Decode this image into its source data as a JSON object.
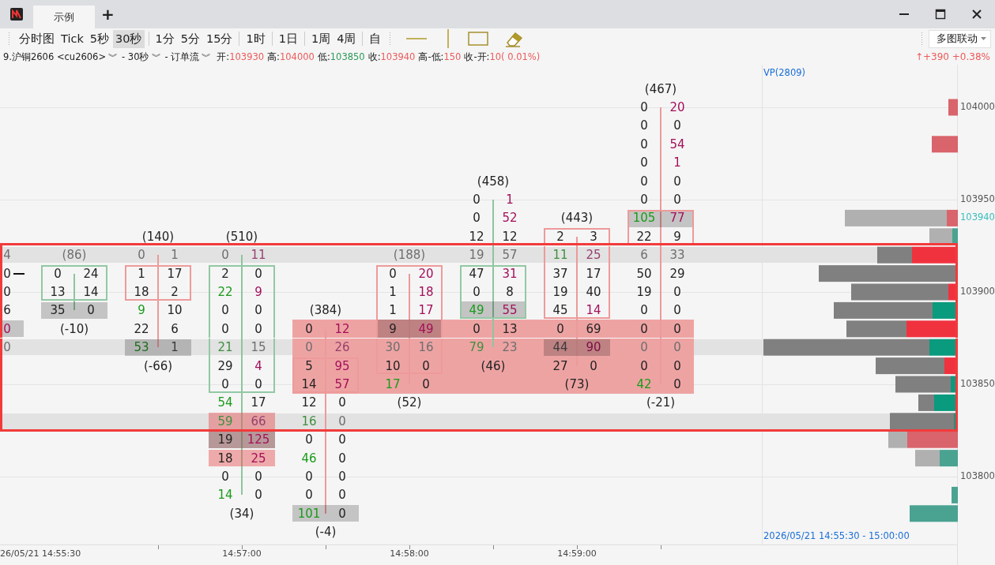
{
  "window": {
    "tabs": [
      {
        "label": "示例",
        "selected": true
      }
    ],
    "add_tab": "+"
  },
  "toolbar": {
    "period_groups": [
      [
        {
          "label": "分时图",
          "selected": false
        },
        {
          "label": "Tick",
          "selected": false
        },
        {
          "label": "5秒",
          "selected": false
        },
        {
          "label": "30秒",
          "selected": true
        }
      ],
      [
        {
          "label": "1分",
          "selected": false
        },
        {
          "label": "5分",
          "selected": false
        },
        {
          "label": "15分",
          "selected": false
        }
      ],
      [
        {
          "label": "1时",
          "selected": false
        }
      ],
      [
        {
          "label": "1日",
          "selected": false
        }
      ],
      [
        {
          "label": "1周",
          "selected": false
        },
        {
          "label": "4周",
          "selected": false
        }
      ],
      [
        {
          "label": "自",
          "selected": false
        }
      ]
    ],
    "tools": [
      {
        "kind": "hline"
      },
      {
        "kind": "vline"
      },
      {
        "kind": "rect"
      },
      {
        "kind": "eraser"
      }
    ],
    "link_menu": {
      "label": "多图联动"
    }
  },
  "info": {
    "selectors": [
      {
        "label": "9.沪铜2606 <cu2606>",
        "menu": "︾"
      },
      {
        "label": "- 30秒",
        "menu": "︾"
      },
      {
        "label": "- 订单流",
        "menu": "︾"
      }
    ],
    "stats": [
      {
        "label": "开:",
        "value": "103930",
        "rising": true
      },
      {
        "label": "高:",
        "value": "104000",
        "rising": true
      },
      {
        "label": "低:",
        "value": "103850",
        "rising": false
      },
      {
        "label": "收:",
        "value": "103940",
        "rising": true
      },
      {
        "label": "高-低:",
        "value": "150",
        "rising": true
      },
      {
        "label": "收-开:",
        "value": "10( 0.01%)",
        "rising": true
      }
    ],
    "change": {
      "text": "↑+390 +0.38%",
      "rising": true
    }
  },
  "chart": {
    "rows": [
      {},
      {
        "axis_label": "104000"
      },
      {},
      {},
      {},
      {},
      {
        "axis_label": "103950"
      },
      {
        "axis_label": "103940",
        "current": true
      },
      {},
      {
        "band": true,
        "in_selection": true
      },
      {
        "in_selection": true
      },
      {
        "axis_label": "103900",
        "in_selection": true
      },
      {
        "in_selection": true
      },
      {
        "in_selection": true
      },
      {
        "band": true,
        "in_selection": true
      },
      {
        "in_selection": true
      },
      {
        "axis_label": "103850",
        "in_selection": true
      },
      {
        "in_selection": true
      },
      {
        "band": true,
        "in_selection": true
      },
      {},
      {},
      {
        "axis_label": "103800"
      },
      {},
      {},
      {}
    ],
    "columns": [
      {
        "time": "26/05/21 14:55:30",
        "cells": [
          {},
          {},
          {},
          {},
          {},
          {},
          {},
          {},
          {},
          {
            "kind": "plain",
            "ask": "4"
          },
          {
            "kind": "plain",
            "ask": "0",
            "marker": true
          },
          {
            "kind": "plain",
            "ask": "0"
          },
          {
            "kind": "plain",
            "ask": "6"
          },
          {
            "kind": "shaded",
            "ask": "0",
            "ask_hi": true
          },
          {
            "kind": "plain",
            "ask": "0"
          }
        ]
      },
      {
        "rising": true,
        "cells": [
          {},
          {},
          {},
          {},
          {},
          {},
          {},
          {},
          {},
          {
            "kind": "label",
            "label": "(86)"
          },
          {
            "kind": "plain",
            "bid": "0",
            "ask": "24",
            "box": true
          },
          {
            "kind": "plain",
            "bid": "13",
            "ask": "14",
            "box": true
          },
          {
            "kind": "shaded",
            "bid": "35",
            "ask": "0"
          },
          {
            "kind": "label",
            "label": "(-10)"
          }
        ]
      },
      {
        "rising": false,
        "cells": [
          {},
          {},
          {},
          {},
          {},
          {},
          {},
          {},
          {
            "kind": "label",
            "label": "(140)"
          },
          {
            "kind": "plain",
            "bid": "0",
            "ask": "1"
          },
          {
            "kind": "plain",
            "bid": "1",
            "ask": "17",
            "box": true
          },
          {
            "kind": "plain",
            "bid": "18",
            "ask": "2",
            "box": true
          },
          {
            "kind": "plain",
            "bid": "9",
            "ask": "10",
            "bid_hi": true
          },
          {
            "kind": "plain",
            "bid": "22",
            "ask": "6"
          },
          {
            "kind": "shaded",
            "bid": "53",
            "ask": "1",
            "bid_hi": true
          },
          {
            "kind": "label",
            "label": "(-66)"
          }
        ]
      },
      {
        "rising": true,
        "time": "14:57:00",
        "cells": [
          {},
          {},
          {},
          {},
          {},
          {},
          {},
          {},
          {
            "kind": "label",
            "label": "(510)"
          },
          {
            "kind": "plain",
            "bid": "0",
            "ask": "11",
            "ask_hi": true
          },
          {
            "kind": "plain",
            "bid": "2",
            "ask": "0",
            "box": true
          },
          {
            "kind": "plain",
            "bid": "22",
            "ask": "9",
            "bid_hi": true,
            "ask_hi": true,
            "box": true
          },
          {
            "kind": "plain",
            "bid": "0",
            "ask": "0",
            "box": true
          },
          {
            "kind": "plain",
            "bid": "0",
            "ask": "0",
            "box": true
          },
          {
            "kind": "plain",
            "bid": "21",
            "ask": "15",
            "bid_hi": true,
            "box": true
          },
          {
            "kind": "plain",
            "bid": "29",
            "ask": "4",
            "ask_hi": true,
            "box": true
          },
          {
            "kind": "plain",
            "bid": "0",
            "ask": "0",
            "box": true
          },
          {
            "kind": "plain",
            "bid": "54",
            "ask": "17",
            "bid_hi": true
          },
          {
            "kind": "pink",
            "bid": "59",
            "ask": "66",
            "bid_hi": true,
            "ask_hi": true
          },
          {
            "kind": "dark",
            "bid": "19",
            "ask": "125",
            "ask_hi": true
          },
          {
            "kind": "pink",
            "bid": "18",
            "ask": "25",
            "ask_hi": true
          },
          {
            "kind": "plain",
            "bid": "0",
            "ask": "0"
          },
          {
            "kind": "plain",
            "bid": "14",
            "ask": "0",
            "bid_hi": true
          },
          {
            "kind": "label",
            "label": "(34)"
          }
        ]
      },
      {
        "rising": false,
        "cells": [
          {},
          {},
          {},
          {},
          {},
          {},
          {},
          {},
          {},
          {},
          {},
          {},
          {
            "kind": "label",
            "label": "(384)"
          },
          {
            "kind": "plain",
            "bid": "0",
            "ask": "12",
            "ask_hi": true,
            "zone": true
          },
          {
            "kind": "plain",
            "bid": "0",
            "ask": "26",
            "ask_hi": true,
            "zone": true
          },
          {
            "kind": "plain",
            "bid": "5",
            "ask": "95",
            "ask_hi": true,
            "box": true,
            "zone": true
          },
          {
            "kind": "plain",
            "bid": "14",
            "ask": "57",
            "ask_hi": true,
            "box": true,
            "zone": true
          },
          {
            "kind": "plain",
            "bid": "12",
            "ask": "0"
          },
          {
            "kind": "plain",
            "bid": "16",
            "ask": "0",
            "bid_hi": true
          },
          {
            "kind": "plain",
            "bid": "0",
            "ask": "0"
          },
          {
            "kind": "plain",
            "bid": "46",
            "ask": "0",
            "bid_hi": true
          },
          {
            "kind": "plain",
            "bid": "0",
            "ask": "0"
          },
          {
            "kind": "plain",
            "bid": "0",
            "ask": "0"
          },
          {
            "kind": "shaded",
            "bid": "101",
            "ask": "0",
            "bid_hi": true
          },
          {
            "kind": "label",
            "label": "(-4)"
          }
        ]
      },
      {
        "rising": false,
        "time": "14:58:00",
        "cells": [
          {},
          {},
          {},
          {},
          {},
          {},
          {},
          {},
          {},
          {
            "kind": "label",
            "label": "(188)"
          },
          {
            "kind": "plain",
            "bid": "0",
            "ask": "20",
            "ask_hi": true,
            "box": true
          },
          {
            "kind": "plain",
            "bid": "1",
            "ask": "18",
            "ask_hi": true,
            "box": true
          },
          {
            "kind": "plain",
            "bid": "1",
            "ask": "17",
            "ask_hi": true,
            "box": true
          },
          {
            "kind": "shaded",
            "bid": "9",
            "ask": "49",
            "ask_hi": true,
            "box": true,
            "zone": true
          },
          {
            "kind": "plain",
            "bid": "30",
            "ask": "16",
            "box": true,
            "zone": true
          },
          {
            "kind": "plain",
            "bid": "10",
            "ask": "0",
            "box": true,
            "zone": true
          },
          {
            "kind": "plain",
            "bid": "17",
            "ask": "0",
            "bid_hi": true,
            "zone": true
          },
          {
            "kind": "label",
            "label": "(52)"
          }
        ]
      },
      {
        "rising": true,
        "cells": [
          {},
          {},
          {},
          {},
          {},
          {
            "kind": "label",
            "label": "(458)"
          },
          {
            "kind": "plain",
            "bid": "0",
            "ask": "1",
            "ask_hi": true
          },
          {
            "kind": "plain",
            "bid": "0",
            "ask": "52",
            "ask_hi": true
          },
          {
            "kind": "plain",
            "bid": "12",
            "ask": "12"
          },
          {
            "kind": "plain",
            "bid": "19",
            "ask": "57"
          },
          {
            "kind": "plain",
            "bid": "47",
            "ask": "31",
            "ask_hi": true,
            "box": true
          },
          {
            "kind": "plain",
            "bid": "0",
            "ask": "8",
            "box": true
          },
          {
            "kind": "shaded",
            "bid": "49",
            "ask": "55",
            "bid_hi": true,
            "ask_hi": true,
            "box": true
          },
          {
            "kind": "plain",
            "bid": "0",
            "ask": "13",
            "zone": true
          },
          {
            "kind": "plain",
            "bid": "79",
            "ask": "23",
            "bid_hi": true,
            "zone": true
          },
          {
            "kind": "label",
            "label": "(46)",
            "zone": true
          },
          {
            "zone": true
          }
        ]
      },
      {
        "rising": false,
        "time": "14:59:00",
        "cells": [
          {},
          {},
          {},
          {},
          {},
          {},
          {},
          {
            "kind": "label",
            "label": "(443)"
          },
          {
            "kind": "plain",
            "bid": "2",
            "ask": "3",
            "box": true
          },
          {
            "kind": "plain",
            "bid": "11",
            "ask": "25",
            "bid_hi": true,
            "ask_hi": true,
            "box": true
          },
          {
            "kind": "plain",
            "bid": "37",
            "ask": "17",
            "box": true
          },
          {
            "kind": "plain",
            "bid": "19",
            "ask": "40",
            "box": true
          },
          {
            "kind": "plain",
            "bid": "45",
            "ask": "14",
            "ask_hi": true,
            "box": true
          },
          {
            "kind": "plain",
            "bid": "0",
            "ask": "69",
            "zone": true
          },
          {
            "kind": "shaded",
            "bid": "44",
            "ask": "90",
            "ask_hi": true,
            "zone": true
          },
          {
            "kind": "plain",
            "bid": "27",
            "ask": "0",
            "zone": true
          },
          {
            "kind": "label",
            "label": "(73)",
            "zone": true
          }
        ]
      },
      {
        "rising": false,
        "cells": [
          {
            "kind": "label",
            "label": "(467)"
          },
          {
            "kind": "plain",
            "bid": "0",
            "ask": "20",
            "ask_hi": true
          },
          {
            "kind": "plain",
            "bid": "0",
            "ask": "0"
          },
          {
            "kind": "plain",
            "bid": "0",
            "ask": "54",
            "ask_hi": true
          },
          {
            "kind": "plain",
            "bid": "0",
            "ask": "1",
            "ask_hi": true
          },
          {
            "kind": "plain",
            "bid": "0",
            "ask": "0"
          },
          {
            "kind": "plain",
            "bid": "0",
            "ask": "0"
          },
          {
            "kind": "shaded",
            "bid": "105",
            "ask": "77",
            "bid_hi": true,
            "ask_hi": true,
            "box": true
          },
          {
            "kind": "plain",
            "bid": "22",
            "ask": "9",
            "box": true
          },
          {
            "kind": "plain",
            "bid": "6",
            "ask": "33"
          },
          {
            "kind": "plain",
            "bid": "50",
            "ask": "29"
          },
          {
            "kind": "plain",
            "bid": "19",
            "ask": "0"
          },
          {
            "kind": "plain",
            "bid": "0",
            "ask": "0"
          },
          {
            "kind": "plain",
            "bid": "0",
            "ask": "0",
            "zone": true
          },
          {
            "kind": "plain",
            "bid": "0",
            "ask": "0",
            "zone": true
          },
          {
            "kind": "plain",
            "bid": "0",
            "ask": "0",
            "zone": true
          },
          {
            "kind": "plain",
            "bid": "42",
            "ask": "0",
            "bid_hi": true,
            "zone": true
          },
          {
            "kind": "label",
            "label": "(-21)"
          }
        ]
      }
    ],
    "profile": {
      "title": "VP(2809)",
      "range": "2026/05/21 14:55:30 - 15:00:00"
    }
  }
}
